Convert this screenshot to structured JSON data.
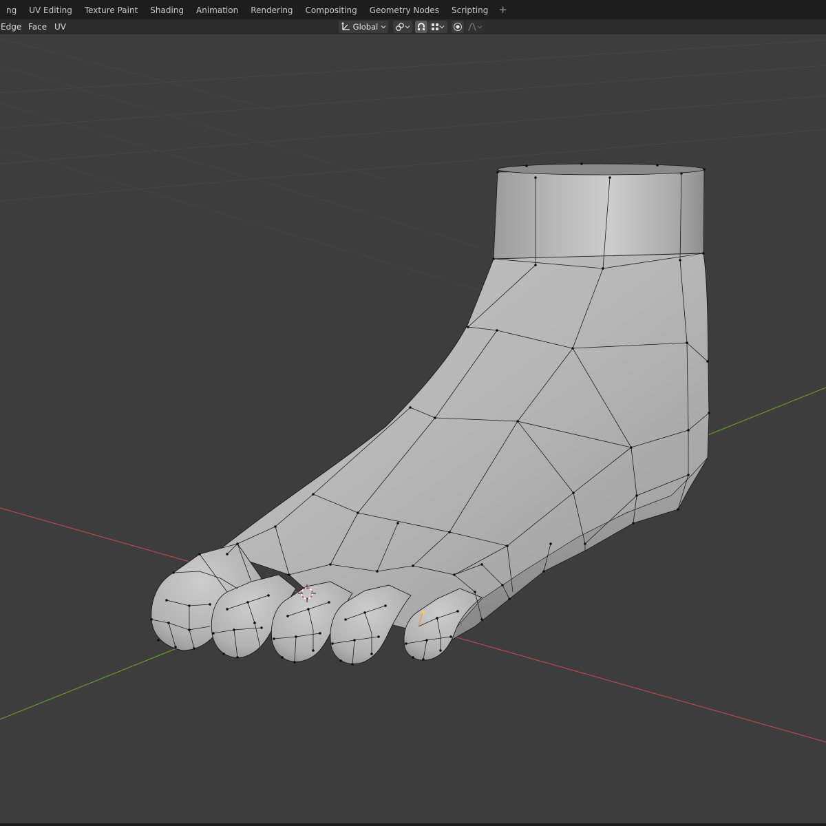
{
  "workspace_tabs": [
    "ng",
    "UV Editing",
    "Texture Paint",
    "Shading",
    "Animation",
    "Rendering",
    "Compositing",
    "Geometry Nodes",
    "Scripting"
  ],
  "add_tab": "+",
  "header": {
    "menu": {
      "edge": "Edge",
      "face": "Face",
      "uv": "UV"
    },
    "transform_orientation": "Global",
    "icons": {
      "orientation": "transform-orientation-icon",
      "pivot": "pivot-point-icon",
      "snap": "snap-magnet-icon",
      "snap_target": "snap-increment-icon",
      "proportional": "proportional-editing-icon",
      "falloff": "falloff-curve-icon"
    }
  },
  "viewport": {
    "grid": true,
    "x_axis_color": "#b8484e",
    "y_axis_color": "#6a9a2c",
    "mesh_color": "#b7b7b7",
    "object": "foot mesh"
  },
  "colors": {
    "topbar": "#1d1d1d",
    "header": "#2b2b2b",
    "viewport": "#3d3d3d",
    "accent": "#ff8b1f"
  }
}
